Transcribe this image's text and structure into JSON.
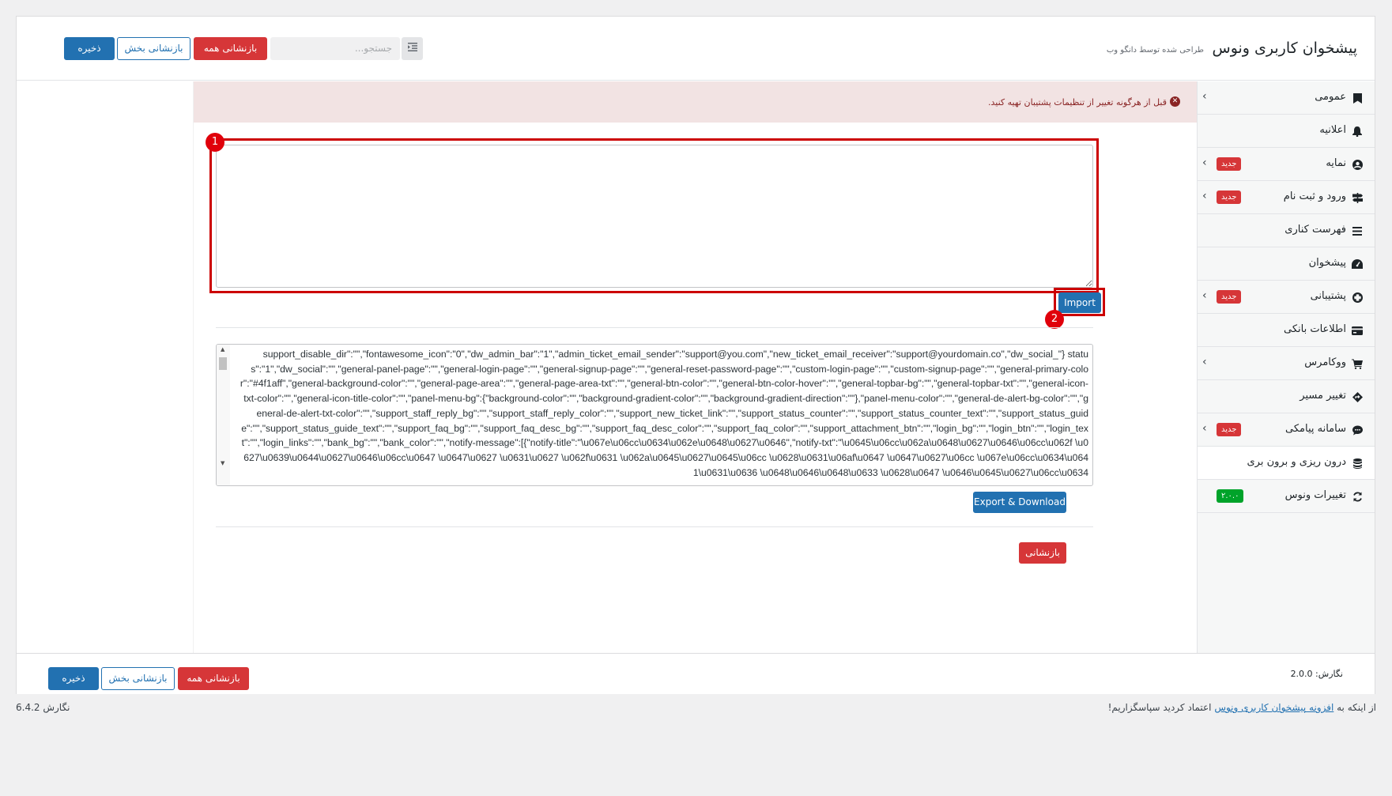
{
  "header": {
    "title": "پیشخوان کاربری ونوس",
    "subtitle": "طراحی شده توسط دانگو وب",
    "search_placeholder": "جستجو...",
    "reset_all_label": "بازنشانی همه",
    "reset_section_label": "بازنشانی بخش",
    "save_label": "ذخیره"
  },
  "sidebar": {
    "items": [
      {
        "label": "عمومی",
        "icon": "bookmark-icon",
        "badge": "",
        "chevron": true
      },
      {
        "label": "اعلانیه",
        "icon": "bell-icon",
        "badge": "",
        "chevron": false
      },
      {
        "label": "نمایه",
        "icon": "user-circle-icon",
        "badge": "جدید",
        "chevron": true
      },
      {
        "label": "ورود و ثبت نام",
        "icon": "signpost-icon",
        "badge": "جدید",
        "chevron": true
      },
      {
        "label": "فهرست کناری",
        "icon": "list-icon",
        "badge": "",
        "chevron": false
      },
      {
        "label": "پیشخوان",
        "icon": "dashboard-icon",
        "badge": "",
        "chevron": false
      },
      {
        "label": "پشتیبانی",
        "icon": "lifebuoy-icon",
        "badge": "جدید",
        "chevron": true
      },
      {
        "label": "اطلاعات بانکی",
        "icon": "credit-card-icon",
        "badge": "",
        "chevron": false
      },
      {
        "label": "ووکامرس",
        "icon": "cart-icon",
        "badge": "",
        "chevron": true
      },
      {
        "label": "تغییر مسیر",
        "icon": "diamond-arrow-icon",
        "badge": "",
        "chevron": false
      },
      {
        "label": "سامانه پیامکی",
        "icon": "sms-icon",
        "badge": "جدید",
        "chevron": true
      },
      {
        "label": "درون ریزی و برون بری",
        "icon": "database-icon",
        "badge": "",
        "chevron": false
      },
      {
        "label": "تغییرات ونوس",
        "icon": "refresh-icon",
        "badge": "۲.۰.۰",
        "chevron": false
      }
    ]
  },
  "alert": {
    "text": "قبل از هرگونه تغییر از تنظیمات پشتیبان تهیه کنید."
  },
  "import": {
    "value": "",
    "button_label": "Import",
    "marker": "1",
    "button_marker": "2"
  },
  "export": {
    "text": "support_disable_dir\":\"\",\"fontawesome_icon\":\"0\",\"dw_admin_bar\":\"1\",\"admin_ticket_email_sender\":\"support@you.com\",\"new_ticket_email_receiver\":\"support@yourdomain.co\",\"dw_social_\"} status\":\"1\",\"dw_social\":\"\",\"general-panel-page\":\"\",\"general-login-page\":\"\",\"general-signup-page\":\"\",\"general-reset-password-page\":\"\",\"custom-login-page\":\"\",\"custom-signup-page\":\"\",\"general-primary-color\":\"#4f1aff\",\"general-background-color\":\"\",\"general-page-area\":\"\",\"general-page-area-txt\":\"\",\"general-btn-color\":\"\",\"general-btn-color-hover\":\"\",\"general-topbar-bg\":\"\",\"general-topbar-txt\":\"\",\"general-icon-txt-color\":\"\",\"general-icon-title-color\":\"\",\"panel-menu-bg\":{\"background-color\":\"\",\"background-gradient-color\":\"\",\"background-gradient-direction\":\"\"},\"panel-menu-color\":\"\",\"general-de-alert-bg-color\":\"\",\"general-de-alert-txt-color\":\"\",\"support_staff_reply_bg\":\"\",\"support_staff_reply_color\":\"\",\"support_new_ticket_link\":\"\",\"support_status_counter\":\"\",\"support_status_counter_text\":\"\",\"support_status_guide\":\"\",\"support_status_guide_text\":\"\",\"support_faq_bg\":\"\",\"support_faq_desc_bg\":\"\",\"support_faq_desc_color\":\"\",\"support_faq_color\":\"\",\"support_attachment_btn\":\"\",\"login_bg\":\"\",\"login_btn\":\"\",\"login_text\":\"\",\"login_links\":\"\",\"bank_bg\":\"\",\"bank_color\":\"\",\"notify-message\":[{\"notify-title\":\"\\u067e\\u06cc\\u0634\\u062e\\u0648\\u0627\\u0646\",\"notify-txt\":\"\\u0645\\u06cc\\u062a\\u0648\\u0627\\u0646\\u06cc\\u062f \\u0627\\u0639\\u0644\\u0627\\u0646\\u06cc\\u0647 \\u0647\\u0627 \\u0631\\u0627 \\u062f\\u0631 \\u062a\\u0645\\u0627\\u0645\\u06cc \\u0628\\u0631\\u06af\\u0647 \\u0647\\u0627\\u06cc \\u067e\\u06cc\\u0634\\u0641\\u0631\\u0636 \\u0648\\u0646\\u0648\\u0633 \\u0628\\u0647 \\u0646\\u0645\\u0627\\u06cc\\u0634",
    "button_label": "Export & Download"
  },
  "reset_button_label": "بازنشانی",
  "footer": {
    "version_label": "نگارش: 2.0.0",
    "reset_all_label": "بازنشانی همه",
    "reset_section_label": "بازنشانی بخش",
    "save_label": "ذخیره"
  },
  "wp_footer": {
    "thanks_prefix": "از اینکه به ",
    "thanks_link": "افزونه پیشخوان کاربری ونوس",
    "thanks_suffix": " اعتماد کردید سپاسگزاریم!",
    "wp_version": "نگارش 6.4.2"
  },
  "colors": {
    "primary": "#2271b1",
    "danger": "#d63638",
    "success": "#00a32a",
    "highlight": "#cc0000",
    "alert_bg": "#f2e3e3"
  }
}
